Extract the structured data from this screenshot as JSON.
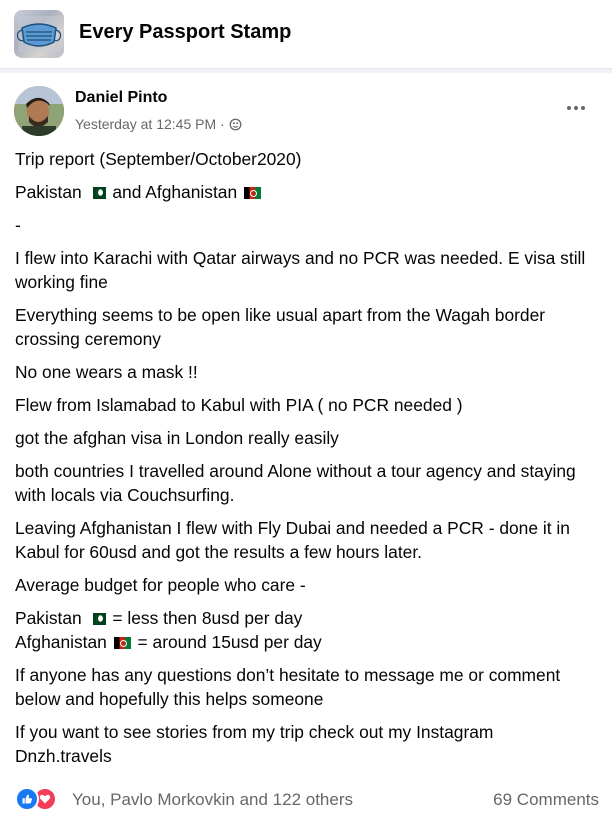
{
  "group": {
    "name": "Every Passport Stamp",
    "thumbnail_icon": "mask-stamp-icon"
  },
  "post": {
    "author": "Daniel Pinto",
    "timestamp": "Yesterday at 12:45 PM · ",
    "privacy_icon": "globe-icon",
    "menu_icon": "more-options-icon",
    "lines": [
      "Trip report (September/October2020)",
      "Pakistan",
      "and Afghanistan",
      "-",
      "I flew into Karachi with Qatar airways and no PCR was needed. E visa still working fine",
      "Everything seems to be open like usual apart from the Wagah border crossing ceremony",
      "No one wears a mask !!",
      "Flew from Islamabad to Kabul with PIA ( no PCR needed )",
      "got the afghan visa in London really easily",
      "both countries I travelled around Alone without a tour agency and staying with locals via Couchsurfing.",
      "Leaving Afghanistan I flew with Fly Dubai and needed a PCR - done it in Kabul for 60usd and got the results a few hours later.",
      "Average budget for people who care -",
      "Pakistan",
      "= less then 8usd per day",
      "Afghanistan",
      "= around 15usd per day",
      "If anyone has any questions don’t hesitate to message me or comment below and hopefully this helps someone",
      "If you want to see stories from my trip check out my Instagram",
      "Dnzh.travels"
    ]
  },
  "footer": {
    "reactions_text": "You, Pavlo Morkovkin and 122 others",
    "comments_text": "69 Comments",
    "like_color": "#1877f2",
    "love_color": "#f33e58"
  },
  "colors": {
    "text": "#050505",
    "secondary": "#65676b",
    "divider": "#e4e6eb"
  }
}
